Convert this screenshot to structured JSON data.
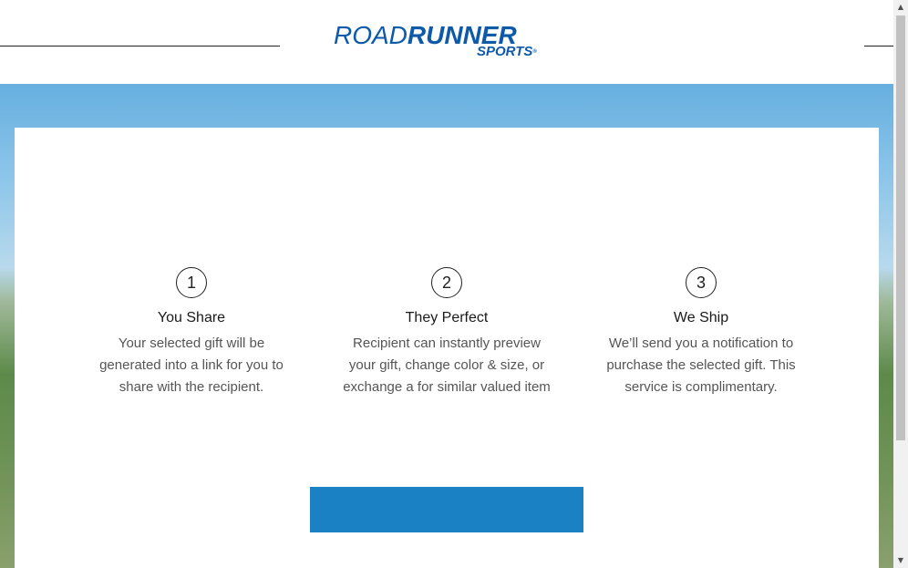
{
  "header": {
    "logo_top_thin": "ROAD",
    "logo_top_bold": "RUNNER",
    "logo_sub": "SPORTS",
    "logo_mark": "®",
    "brand_color": "#0f5aa8"
  },
  "steps": [
    {
      "number": "1",
      "title": "You Share",
      "description": "Your selected gift will be generated into a link for you to share with the recipient."
    },
    {
      "number": "2",
      "title": "They Perfect",
      "description": "Recipient can instantly preview your gift, change color & size, or exchange a for similar valued item"
    },
    {
      "number": "3",
      "title": "We Ship",
      "description": "We’ll send you a notification to purchase the selected gift. This service is complimentary."
    }
  ],
  "cta": {
    "label": "",
    "color": "#1a82c4"
  },
  "scrollbar": {
    "up_icon": "scroll-up-arrow",
    "down_icon": "scroll-down-arrow"
  }
}
